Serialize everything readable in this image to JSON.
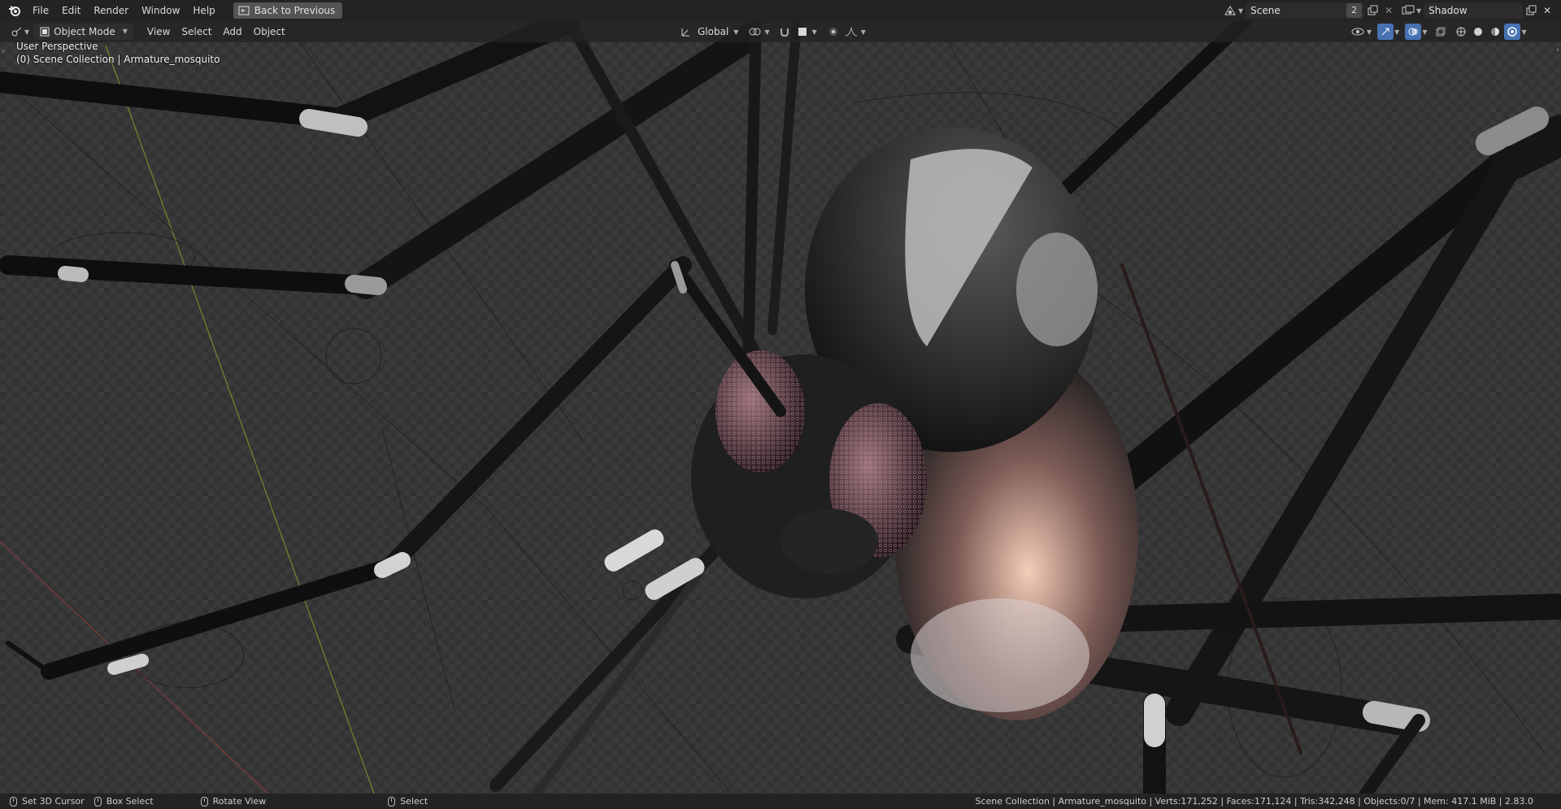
{
  "topbar": {
    "menus": [
      "File",
      "Edit",
      "Render",
      "Window",
      "Help"
    ],
    "back_button": "Back to Previous",
    "scene_name": "Scene",
    "scene_users": "2",
    "view_layer": "Shadow"
  },
  "header": {
    "mode": "Object Mode",
    "menus": [
      "View",
      "Select",
      "Add",
      "Object"
    ],
    "orientation": "Global"
  },
  "viewport": {
    "perspective_label": "User Perspective",
    "collection_label": "(0) Scene Collection | Armature_mosquito"
  },
  "statusbar": {
    "set_cursor": "Set 3D Cursor",
    "box_select": "Box Select",
    "rotate_view": "Rotate View",
    "select": "Select",
    "stats": "Scene Collection | Armature_mosquito | Verts:171,252 | Faces:171,124 | Tris:342,248 | Objects:0/7 | Mem: 417.1 MiB | 2.83.0"
  },
  "colors": {
    "topbar_bg": "#232323",
    "viewport_bg": "#3a3a3a",
    "active_blue": "#4772b3",
    "x_axis": "#8c3a3a",
    "y_axis": "#6f8a2a"
  }
}
